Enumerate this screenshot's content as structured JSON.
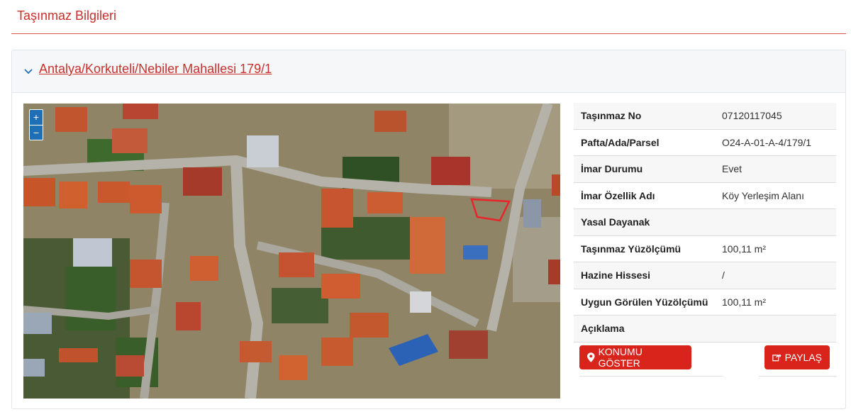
{
  "page": {
    "title": "Taşınmaz Bilgileri"
  },
  "panel": {
    "link_text": "Antalya/Korkuteli/Nebiler Mahallesi 179/1"
  },
  "map": {
    "zoom_in": "+",
    "zoom_out": "−",
    "highlight_color": "#e8242c"
  },
  "info": {
    "rows": [
      {
        "label": "Taşınmaz No",
        "value": "07120117045"
      },
      {
        "label": "Pafta/Ada/Parsel",
        "value": "O24-A-01-A-4/179/1"
      },
      {
        "label": "İmar Durumu",
        "value": "Evet"
      },
      {
        "label": "İmar Özellik Adı",
        "value": "Köy Yerleşim Alanı"
      },
      {
        "label": "Yasal Dayanak",
        "value": ""
      },
      {
        "label": "Taşınmaz Yüzölçümü",
        "value": "100,11 m²"
      },
      {
        "label": "Hazine Hissesi",
        "value": "/"
      },
      {
        "label": "Uygun Görülen Yüzölçümü",
        "value": "100,11 m²"
      },
      {
        "label": "Açıklama",
        "value": ""
      }
    ]
  },
  "buttons": {
    "konum": "KONUMU GÖSTER",
    "paylas": "PAYLAŞ"
  },
  "colors": {
    "accent": "#c9302c",
    "button": "#d9241c",
    "map_control": "#1f6fb6"
  }
}
